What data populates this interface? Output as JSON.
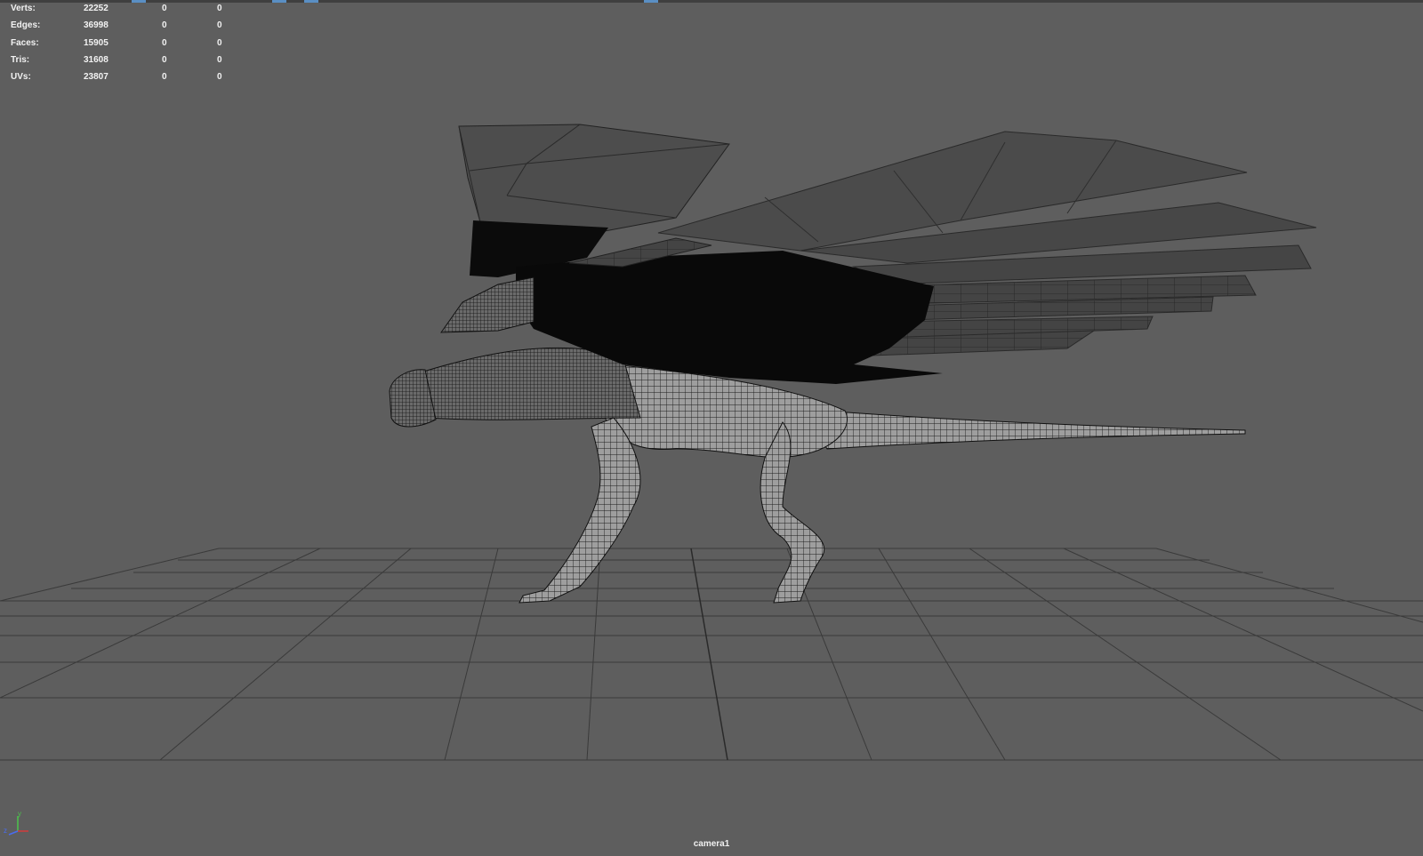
{
  "heads_up_display": {
    "rows": [
      {
        "label": "Verts:",
        "total": "22252",
        "selected": "0",
        "selected_components": "0"
      },
      {
        "label": "Edges:",
        "total": "36998",
        "selected": "0",
        "selected_components": "0"
      },
      {
        "label": "Faces:",
        "total": "15905",
        "selected": "0",
        "selected_components": "0"
      },
      {
        "label": "Tris:",
        "total": "31608",
        "selected": "0",
        "selected_components": "0"
      },
      {
        "label": "UVs:",
        "total": "23807",
        "selected": "0",
        "selected_components": "0"
      }
    ]
  },
  "viewport": {
    "camera_name": "camera1",
    "background_color": "#5e5e5e",
    "grid_color": "#3e3e3e",
    "model": "winged creature (wireframe on shaded)"
  },
  "axis_gizmo": {
    "x_label": "",
    "y_label": "y",
    "z_label": "z"
  },
  "colors": {
    "x_axis": "#d23b3b",
    "y_axis": "#4cc34c",
    "z_axis": "#4a6cf0",
    "strip_accent": "#5a8fc4"
  }
}
